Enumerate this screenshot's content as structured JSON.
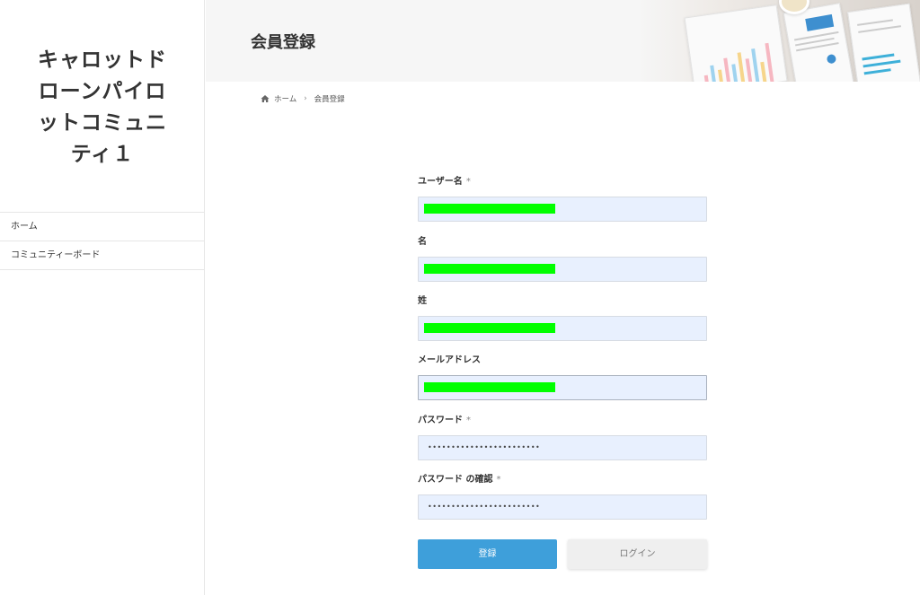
{
  "site": {
    "title_lines": [
      "キャロットド",
      "ローンパイロ",
      "ットコミュニ",
      "ティ１"
    ]
  },
  "nav": {
    "items": [
      {
        "label": "ホーム"
      },
      {
        "label": "コミュニティーボード"
      }
    ]
  },
  "page": {
    "title": "会員登録"
  },
  "breadcrumb": {
    "home": "ホーム",
    "separator": "›",
    "current": "会員登録"
  },
  "form": {
    "required_mark": "*",
    "fields": [
      {
        "label": "ユーザー名",
        "required": true,
        "value": "",
        "redacted": true
      },
      {
        "label": "名",
        "required": false,
        "value": "",
        "redacted": true
      },
      {
        "label": "姓",
        "required": false,
        "value": "",
        "redacted": true
      },
      {
        "label": "メールアドレス",
        "required": false,
        "value": "",
        "redacted": true
      },
      {
        "label": "パスワード",
        "required": true,
        "value": "••••••••••••••••••••••••",
        "redacted": false
      },
      {
        "label": "パスワード の確認",
        "required": true,
        "value": "••••••••••••••••••••••••",
        "redacted": false
      }
    ],
    "submit_label": "登録",
    "login_label": "ログイン"
  },
  "colors": {
    "primary_button": "#3e9fda",
    "input_background": "#e8f0fe",
    "redaction": "#00ff00"
  }
}
